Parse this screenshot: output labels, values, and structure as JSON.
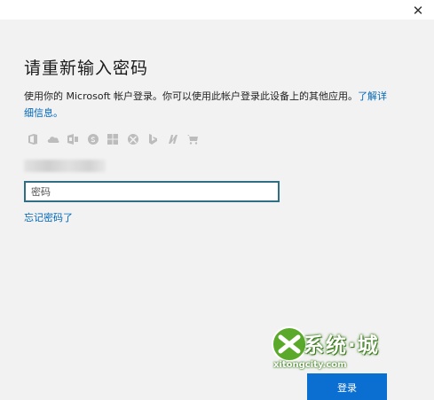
{
  "window": {
    "close_glyph": "✕"
  },
  "dialog": {
    "title": "请重新输入密码",
    "desc_text": "使用你的 Microsoft 帐户登录。你可以使用此帐户登录此设备上的其他应用。",
    "learn_more_link": "了解详细信息。",
    "service_icons": [
      "office-icon",
      "onedrive-icon",
      "outlook-icon",
      "skype-icon",
      "windows-icon",
      "xbox-icon",
      "bing-icon",
      "msn-icon",
      "store-icon"
    ],
    "password_placeholder": "密码",
    "forgot_password": "忘记密码了",
    "signin_button": "登录"
  },
  "watermark": {
    "brand": "系统·城",
    "url": "xitongcity.com"
  },
  "colors": {
    "accent": "#0067b8",
    "button": "#0a6fd1",
    "field_border": "#2e6f85",
    "background": "#f2f2f2"
  }
}
